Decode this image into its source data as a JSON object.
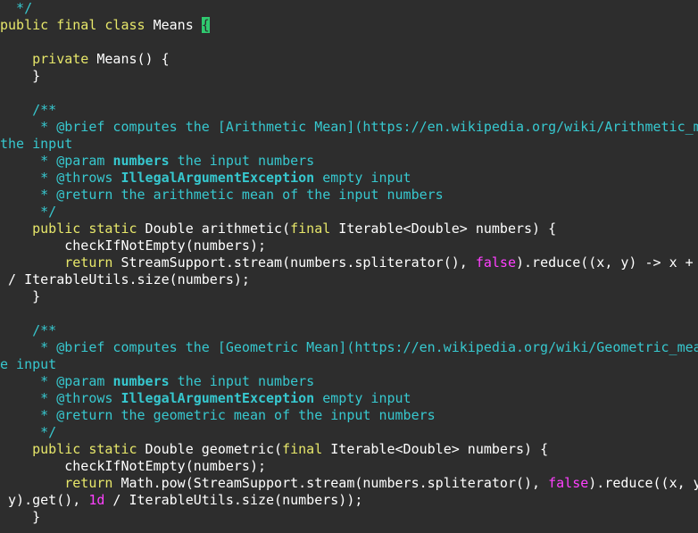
{
  "code_lines": [
    [
      {
        "t": "c",
        "s": "  */"
      }
    ],
    [
      {
        "t": "k",
        "s": "public final class"
      },
      {
        "t": "p",
        "s": " Means "
      },
      {
        "t": "cur",
        "s": "{"
      }
    ],
    [],
    [
      {
        "t": "p",
        "s": "    "
      },
      {
        "t": "k",
        "s": "private"
      },
      {
        "t": "p",
        "s": " Means() {"
      }
    ],
    [
      {
        "t": "p",
        "s": "    }"
      }
    ],
    [],
    [
      {
        "t": "c",
        "s": "    /**"
      }
    ],
    [
      {
        "t": "c",
        "s": "     * @brief computes the [Arithmetic Mean](https://en.wikipedia.org/wiki/Arithmetic_mean) of"
      }
    ],
    [
      {
        "t": "c",
        "s": "the input"
      }
    ],
    [
      {
        "t": "c",
        "s": "     * @param "
      },
      {
        "t": "tag",
        "s": "numbers"
      },
      {
        "t": "c",
        "s": " the input numbers"
      }
    ],
    [
      {
        "t": "c",
        "s": "     * @throws "
      },
      {
        "t": "tag",
        "s": "IllegalArgumentException"
      },
      {
        "t": "c",
        "s": " empty input"
      }
    ],
    [
      {
        "t": "c",
        "s": "     * @return the arithmetic mean of the input numbers"
      }
    ],
    [
      {
        "t": "c",
        "s": "     */"
      }
    ],
    [
      {
        "t": "p",
        "s": "    "
      },
      {
        "t": "k",
        "s": "public static"
      },
      {
        "t": "p",
        "s": " Double arithmetic("
      },
      {
        "t": "k",
        "s": "final"
      },
      {
        "t": "p",
        "s": " Iterable<Double> numbers) {"
      }
    ],
    [
      {
        "t": "p",
        "s": "        checkIfNotEmpty(numbers);"
      }
    ],
    [
      {
        "t": "p",
        "s": "        "
      },
      {
        "t": "k",
        "s": "return"
      },
      {
        "t": "p",
        "s": " StreamSupport.stream(numbers.spliterator(), "
      },
      {
        "t": "l",
        "s": "false"
      },
      {
        "t": "p",
        "s": ").reduce((x, y) -> x + y).get()"
      }
    ],
    [
      {
        "t": "p",
        "s": " / IterableUtils.size(numbers);"
      }
    ],
    [
      {
        "t": "p",
        "s": "    }"
      }
    ],
    [],
    [
      {
        "t": "c",
        "s": "    /**"
      }
    ],
    [
      {
        "t": "c",
        "s": "     * @brief computes the [Geometric Mean](https://en.wikipedia.org/wiki/Geometric_mean) of th"
      }
    ],
    [
      {
        "t": "c",
        "s": "e input"
      }
    ],
    [
      {
        "t": "c",
        "s": "     * @param "
      },
      {
        "t": "tag",
        "s": "numbers"
      },
      {
        "t": "c",
        "s": " the input numbers"
      }
    ],
    [
      {
        "t": "c",
        "s": "     * @throws "
      },
      {
        "t": "tag",
        "s": "IllegalArgumentException"
      },
      {
        "t": "c",
        "s": " empty input"
      }
    ],
    [
      {
        "t": "c",
        "s": "     * @return the geometric mean of the input numbers"
      }
    ],
    [
      {
        "t": "c",
        "s": "     */"
      }
    ],
    [
      {
        "t": "p",
        "s": "    "
      },
      {
        "t": "k",
        "s": "public static"
      },
      {
        "t": "p",
        "s": " Double geometric("
      },
      {
        "t": "k",
        "s": "final"
      },
      {
        "t": "p",
        "s": " Iterable<Double> numbers) {"
      }
    ],
    [
      {
        "t": "p",
        "s": "        checkIfNotEmpty(numbers);"
      }
    ],
    [
      {
        "t": "p",
        "s": "        "
      },
      {
        "t": "k",
        "s": "return"
      },
      {
        "t": "p",
        "s": " Math.pow(StreamSupport.stream(numbers.spliterator(), "
      },
      {
        "t": "l",
        "s": "false"
      },
      {
        "t": "p",
        "s": ").reduce((x, y) -> x *"
      }
    ],
    [
      {
        "t": "p",
        "s": " y).get(), "
      },
      {
        "t": "l",
        "s": "1d"
      },
      {
        "t": "p",
        "s": " / IterableUtils.size(numbers));"
      }
    ],
    [
      {
        "t": "p",
        "s": "    }"
      }
    ]
  ]
}
